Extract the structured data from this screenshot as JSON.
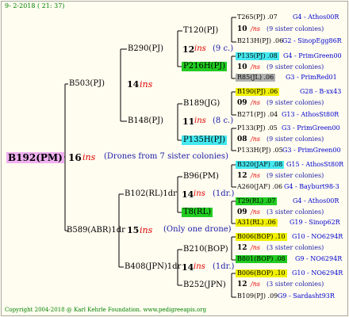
{
  "date": "9- 2-2018 ( 21: 37)",
  "footer": "Copyright 2004-2018 @ Karl Kehrle Foundation.   www.pedigreeapis.org",
  "colors": {
    "magenta": "#f0b0f0",
    "green": "#22cc22",
    "cyan": "#44e8f0",
    "yellow": "#f0f000",
    "grey": "#b0b0b0",
    "ins": "#e00000"
  },
  "root": {
    "name": "B192(PM)",
    "gen": "16",
    "ins": "ins",
    "note": "(Drones from 7 sister colonies)"
  },
  "gen1": [
    {
      "name": "B503(PJ)",
      "gen": "14",
      "ins": "ins"
    },
    {
      "name": "B589(ABR)1dr",
      "gen": "15",
      "ins": "ins",
      "note": "(Only one drone)"
    }
  ],
  "gen2": [
    {
      "name": "B290(PJ)",
      "gen": "12",
      "ins": "ins",
      "note": "(9 c.)"
    },
    {
      "name": "B148(PJ)",
      "gen": "11",
      "ins": "ins",
      "note": "(8 c.)"
    },
    {
      "name": "B102(RL)1dr",
      "gen": "14",
      "ins": "ins",
      "note": "(1dr.)"
    },
    {
      "name": "B408(JPN)1dr",
      "gen": "14",
      "ins": "ins",
      "note": "(1dr.)"
    }
  ],
  "gen3": [
    {
      "name": "T120(PJ)"
    },
    {
      "name": "P216H(PJ)"
    },
    {
      "name": "B189(JG)"
    },
    {
      "name": "P135H(PJ)"
    },
    {
      "name": "B96(PM)"
    },
    {
      "name": "T8(RL)"
    },
    {
      "name": "B210(BOP)"
    },
    {
      "name": "B252(JPN)"
    }
  ],
  "gen4": [
    {
      "top": "T265(PJ) .07",
      "top_breeder": "G4 - Athos00R",
      "mid_gen": "10",
      "mid_ins": "/ns",
      "mid_note": "(9 sister colonies)",
      "bot": "B213H(PJ) .06",
      "bot_breeder": "G2 - SinopEgg86R"
    },
    {
      "top": "P135(PJ) .08",
      "top_breeder": "G4 - PrimGreen00",
      "mid_gen": "10",
      "mid_ins": "/ns",
      "mid_note": "(9 sister colonies)",
      "bot": "R85(JL) .06",
      "bot_breeder": "G3 - PrimRed01"
    },
    {
      "top": "B190(PJ) .06",
      "top_breeder": "G28 - B-xx43",
      "mid_gen": "09",
      "mid_ins": "/ns",
      "mid_note": "(9 sister colonies)",
      "bot": "B271(PJ) .04",
      "bot_breeder": "G13 - AthosSt80R"
    },
    {
      "top": "P133(PJ) .05",
      "top_breeder": "G3 - PrimGreen00",
      "mid_gen": "08",
      "mid_ins": "/ns",
      "mid_note": "(9 sister colonies)",
      "bot": "P133H(PJ) .05",
      "bot_breeder": "G3 - PrimGreen00"
    },
    {
      "top": "B320(JAF) .08",
      "top_breeder": "G15 - AthosSt80R",
      "mid_gen": "12",
      "mid_ins": "/ns",
      "mid_note": "(9 sister colonies)",
      "bot": "A260(JAF) .06",
      "bot_breeder": "G4 - Bayburt98-3"
    },
    {
      "top": "T29(RL) .07",
      "top_breeder": "G4 - Athos00R",
      "mid_gen": "09",
      "mid_ins": "/ns",
      "mid_note": "(3 sister colonies)",
      "bot": "A31(RL) .06",
      "bot_breeder": "G19 - Sinop62R"
    },
    {
      "top": "B006(BOP) .10",
      "top_breeder": "G10 - NO6294R",
      "mid_gen": "12",
      "mid_ins": "/ns",
      "mid_note": "(3 sister colonies)",
      "bot": "B801(BOP) .08",
      "bot_breeder": "G9 - NO6294R"
    },
    {
      "top": "B006(BOP) .10",
      "top_breeder": "G10 - NO6294R",
      "mid_gen": "12",
      "mid_ins": "/ns",
      "mid_note": "(3 sister colonies)",
      "bot": "B109(PJ) .09",
      "bot_breeder": "G9 - Sardasht93R"
    }
  ]
}
